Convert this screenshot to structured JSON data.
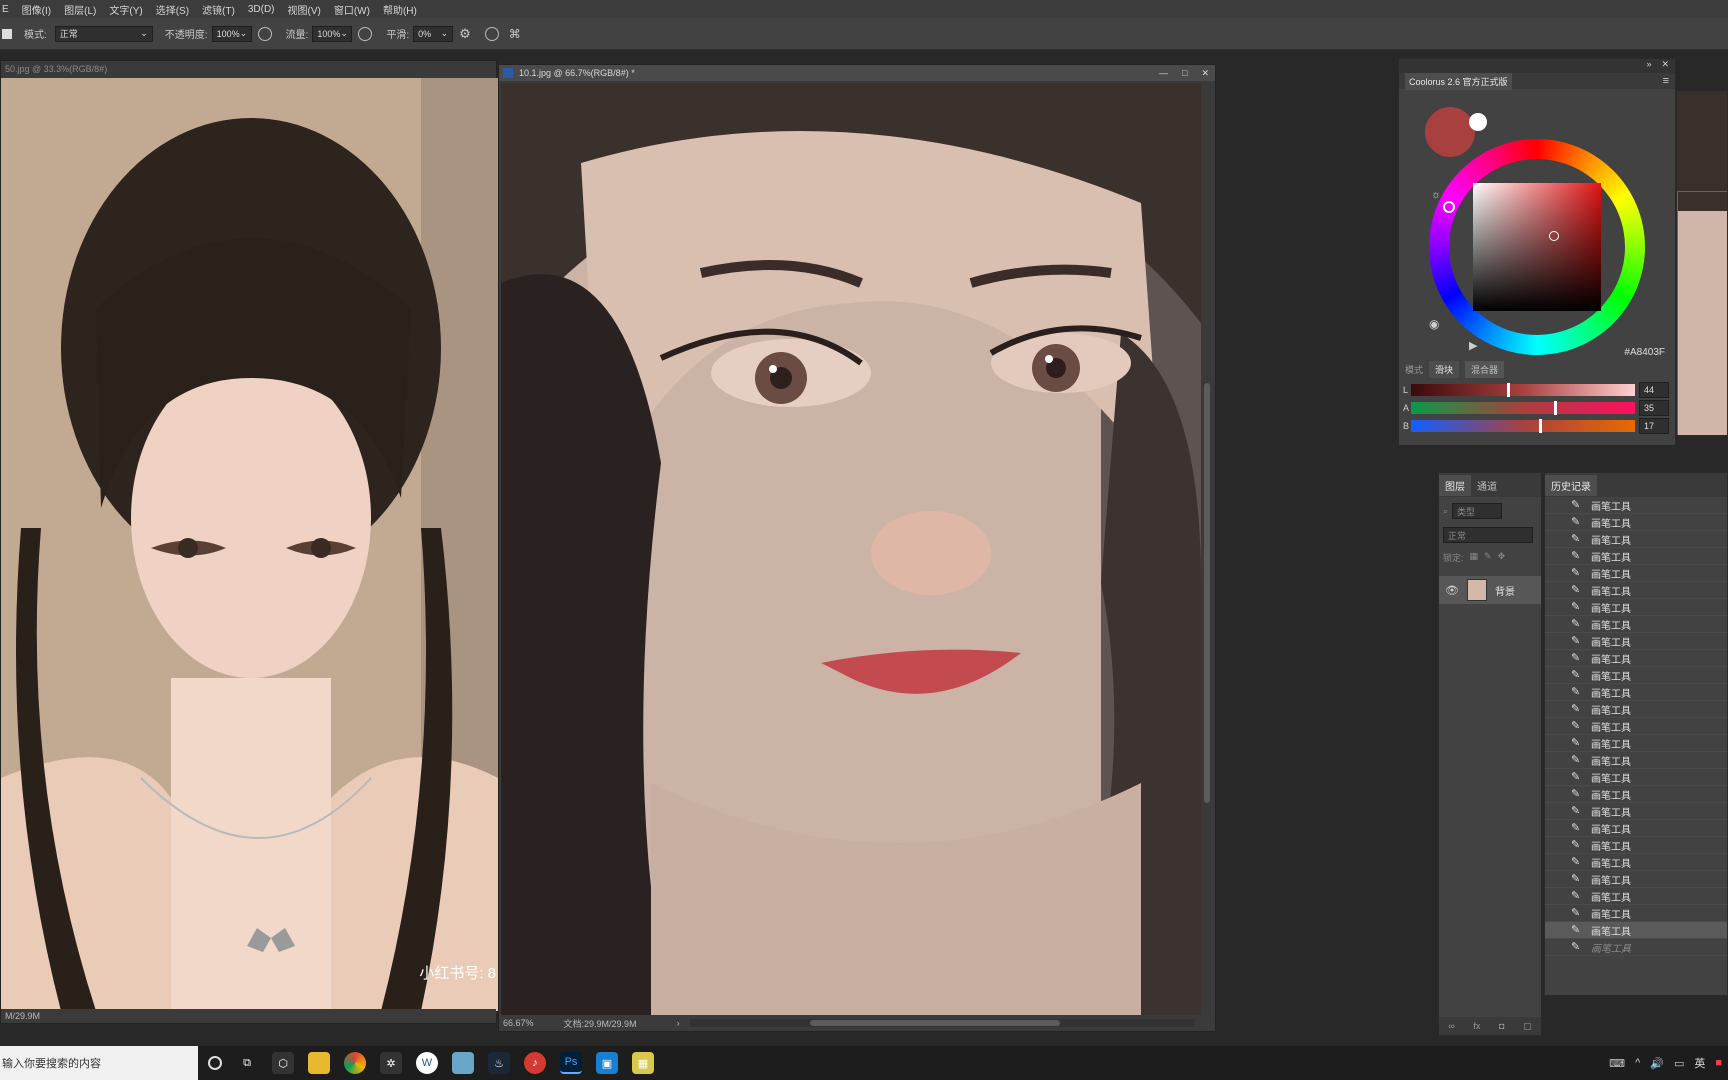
{
  "menu": [
    "E",
    "图像(I)",
    "图层(L)",
    "文字(Y)",
    "选择(S)",
    "滤镜(T)",
    "3D(D)",
    "视图(V)",
    "窗口(W)",
    "帮助(H)"
  ],
  "options": {
    "mode_label": "模式:",
    "mode_value": "正常",
    "opacity_label": "不透明度:",
    "opacity_value": "100%",
    "flow_label": "流量:",
    "flow_value": "100%",
    "smooth_label": "平滑:",
    "smooth_value": "0%"
  },
  "doc_left": {
    "title": "50.jpg @ 33.3%(RGB/8#)",
    "status": "M/29.9M",
    "watermark": "小红书号: 8"
  },
  "doc_main": {
    "title": "10.1.jpg @ 66.7%(RGB/8#) *",
    "zoom": "66.67%",
    "doc_size": "文档:29.9M/29.9M"
  },
  "coolorus": {
    "title": "Coolorus 2.6 官方正式版",
    "hex": "#A8403F",
    "mode_label": "模式",
    "tab_slider": "滑块",
    "tab_mixer": "混合器",
    "sliders": [
      {
        "label": "L",
        "value": "44",
        "pos": 0.43
      },
      {
        "label": "A",
        "value": "35",
        "pos": 0.64
      },
      {
        "label": "B",
        "value": "17",
        "pos": 0.57
      }
    ],
    "current_color": "#A8403F"
  },
  "layers": {
    "tab_layers": "图层",
    "tab_channels": "通道",
    "filter_placeholder": "类型",
    "blend": "正常",
    "lock_label": "锁定:",
    "layer_name": "背景"
  },
  "history": {
    "tab": "历史记录",
    "items": [
      "画笔工具",
      "画笔工具",
      "画笔工具",
      "画笔工具",
      "画笔工具",
      "画笔工具",
      "画笔工具",
      "画笔工具",
      "画笔工具",
      "画笔工具",
      "画笔工具",
      "画笔工具",
      "画笔工具",
      "画笔工具",
      "画笔工具",
      "画笔工具",
      "画笔工具",
      "画笔工具",
      "画笔工具",
      "画笔工具",
      "画笔工具",
      "画笔工具",
      "画笔工具",
      "画笔工具",
      "画笔工具",
      "画笔工具"
    ],
    "last_dim": "画笔工具"
  },
  "taskbar": {
    "search_placeholder": "输入你要搜索的内容",
    "lang": "英"
  }
}
